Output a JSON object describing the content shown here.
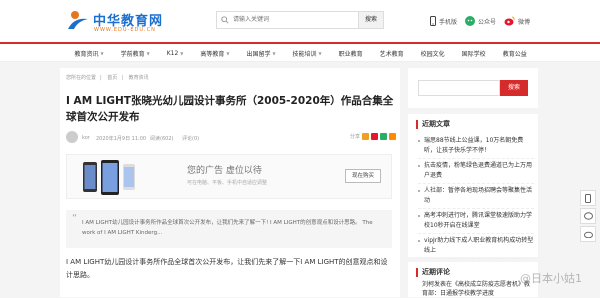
{
  "site": {
    "logo_cn": "中华教育网",
    "logo_en": "WWW.EDU-EDU.CN"
  },
  "search": {
    "placeholder": "请输入关键词",
    "button": "搜索"
  },
  "toplinks": {
    "mobile": "手机版",
    "wechat": "公众号",
    "weibo": "微博"
  },
  "nav": {
    "items": [
      {
        "label": "教育资讯",
        "has_caret": true
      },
      {
        "label": "学前教育",
        "has_caret": true
      },
      {
        "label": "K12",
        "has_caret": true
      },
      {
        "label": "高等教育",
        "has_caret": true
      },
      {
        "label": "出国留学",
        "has_caret": true
      },
      {
        "label": "技能培训",
        "has_caret": true
      },
      {
        "label": "职业教育",
        "has_caret": false
      },
      {
        "label": "艺术教育",
        "has_caret": false
      },
      {
        "label": "校园文化",
        "has_caret": false
      },
      {
        "label": "国际学校",
        "has_caret": false
      },
      {
        "label": "教育公益",
        "has_caret": false
      }
    ]
  },
  "breadcrumb": [
    "您所在的位置",
    "首页",
    "教育资讯"
  ],
  "article": {
    "title": "I AM LIGHT张晓光幼儿园设计事务所（2005-2020年）作品合集全球首次公开发布",
    "author": "kor",
    "date": "2020年1月9日 11:00",
    "views": "阅读(602)",
    "comments": "评论(0)",
    "share_label": "分享",
    "quote": "I AM LIGHT幼儿园设计事务所作品全球首次公开发布，让我们先来了解一下! I AM LIGHT的创意观点和设计思路。 The work of I AM LIGHT Kinderg...",
    "body": "I AM LIGHT幼儿园设计事务所作品全球首次公开发布，让我们先来了解一下I AM LIGHT的创意观点和设计思路。"
  },
  "ad": {
    "title": "您的广告 虚位以待",
    "subtitle": "可在电脑、平板、手机中自适应调整",
    "button": "现在购买"
  },
  "sidebar": {
    "search_button": "搜索",
    "recent_title": "近期文章",
    "recent_items": [
      "瑞思88节线上公益课，10万名朝免费听，让孩子快乐学不停！",
      "抗击疫情，粉笔绿色退费通道已为上万用户退费",
      "人社部：暂停各地现场招聘会等聚集性活动",
      "高考冲刺进行时，腾讯课堂极速版助力学校10秒开启在线课堂",
      "vipJr助力线下成人职业教育机构成功转型线上"
    ],
    "comments_title": "近期评论",
    "comment_text": "刘柯发表在《高校成立防疫志愿者机》教育部：日通报学校教学进度"
  },
  "watermark": "@日本小姑1",
  "colors": {
    "brand_red": "#d62b2b",
    "logo_blue": "#1a6fd1",
    "logo_orange": "#e3771f"
  }
}
